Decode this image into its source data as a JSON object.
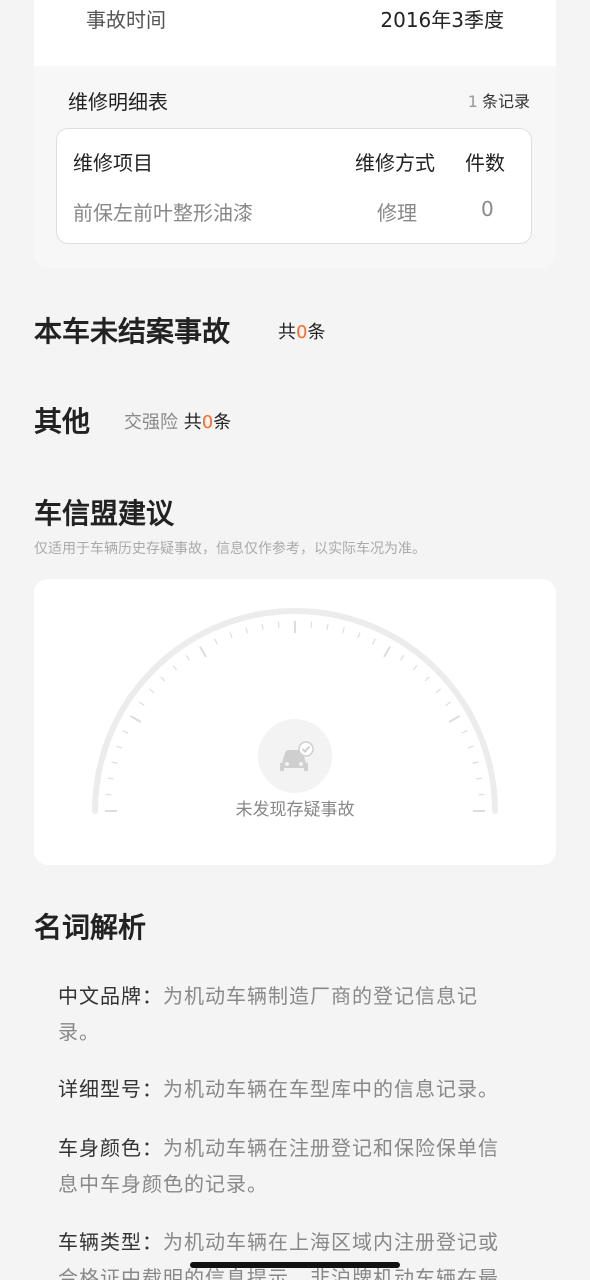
{
  "accident": {
    "time_label": "事故时间",
    "time_value": "2016年3季度"
  },
  "repair": {
    "title": "维修明细表",
    "count": "1",
    "count_suffix": "条记录",
    "headers": [
      "维修项目",
      "维修方式",
      "件数"
    ],
    "rows": [
      {
        "item": "前保左前叶整形油漆",
        "method": "修理",
        "qty": "0"
      }
    ]
  },
  "unsettled": {
    "title": "本车未结案事故",
    "prefix": "共",
    "count": "0",
    "suffix": "条"
  },
  "other": {
    "title": "其他",
    "tag": "交强险",
    "prefix": "共",
    "count": "0",
    "suffix": "条"
  },
  "advice": {
    "title": "车信盟建议",
    "hint": "仅适用于车辆历史存疑事故，信息仅作参考，以实际车况为准。",
    "gauge_label": "未发现存疑事故",
    "icon": "car-check-icon"
  },
  "glossary": {
    "title": "名词解析",
    "items": [
      {
        "term": "中文品牌：",
        "desc_line1": "为机动车辆制造厂商的登记信息记",
        "desc_line2": "录。"
      },
      {
        "term": "详细型号：",
        "desc_line1": "为机动车辆在车型库中的信息记录。",
        "desc_line2": ""
      },
      {
        "term": "车身颜色：",
        "desc_line1": "为机动车辆在注册登记和保险保单信",
        "desc_line2": "息中车身颜色的记录。"
      },
      {
        "term": "车辆类型：",
        "desc_line1": "为机动车辆在上海区域内注册登记或",
        "desc_line2": "合格证中载明的信息提示，非沪牌机动车辆在最"
      }
    ]
  },
  "colors": {
    "accent": "#ff6a2b",
    "card": "#ffffff",
    "background": "#f4f4f4"
  }
}
